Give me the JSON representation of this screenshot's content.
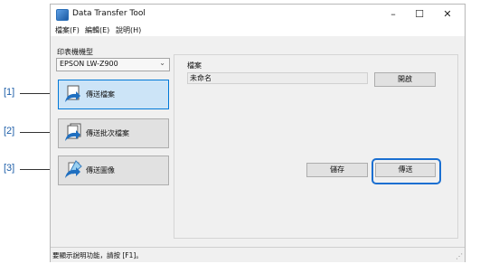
{
  "callouts": [
    "[1]",
    "[2]",
    "[3]"
  ],
  "window": {
    "title": "Data Transfer Tool",
    "controls": {
      "minimize": "–",
      "maximize": "☐",
      "close": "✕"
    }
  },
  "menu": [
    "檔案(F)",
    "編輯(E)",
    "說明(H)"
  ],
  "printer": {
    "label": "印表機機型",
    "selected": "EPSON LW-Z900"
  },
  "buttons": {
    "send_file": "傳送檔案",
    "send_batch": "傳送批次檔案",
    "send_image": "傳送圖像"
  },
  "file": {
    "label": "檔案",
    "name": "未命名",
    "open": "開啟",
    "save": "儲存",
    "send": "傳送"
  },
  "status": "要顯示說明功能，請按 [F1]。",
  "colors": {
    "accent": "#0078d7",
    "callout": "#1f5fa8",
    "highlight": "#1a6fd1"
  }
}
